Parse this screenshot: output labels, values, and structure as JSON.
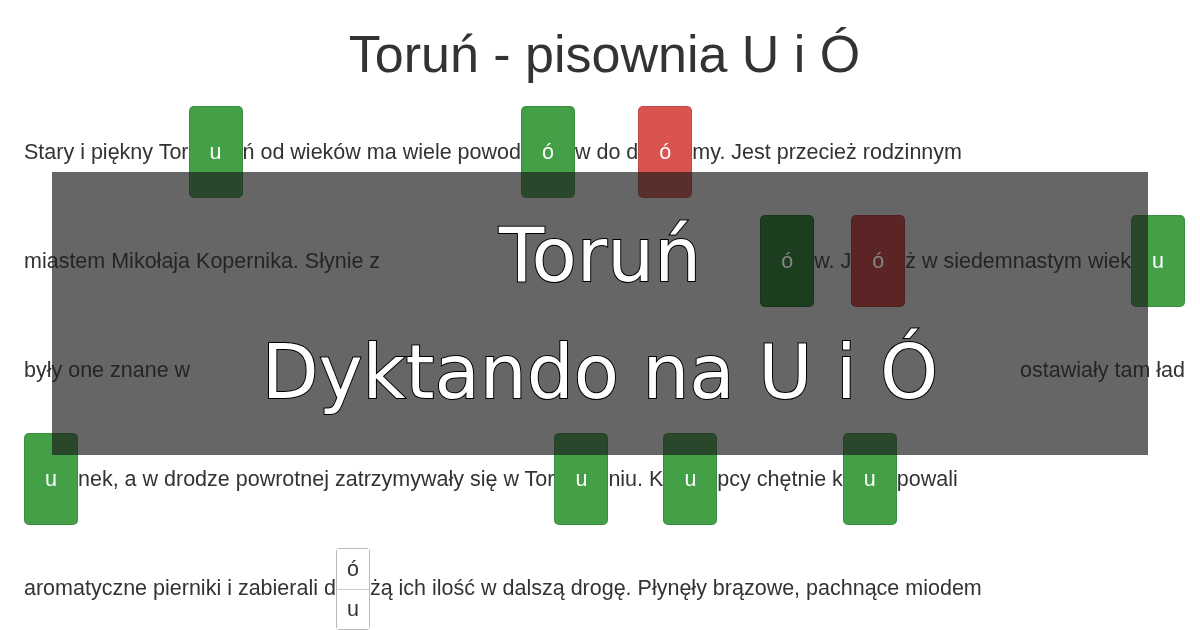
{
  "title": "Toruń - pisownia U i Ó",
  "lines": [
    {
      "segments": [
        {
          "kind": "text",
          "text": "Stary i piękny Tor"
        },
        {
          "kind": "answer",
          "letter": "u",
          "color": "#43a047"
        },
        {
          "kind": "text",
          "text": "ń od wieków ma wiele powod"
        },
        {
          "kind": "answer",
          "letter": "ó",
          "color": "#43a047"
        },
        {
          "kind": "text",
          "text": "w do d"
        },
        {
          "kind": "answer",
          "letter": "ó",
          "color": "#d9534f"
        },
        {
          "kind": "text",
          "text": "my. Jest przecież rodzinnym"
        }
      ]
    },
    {
      "segments": [
        {
          "kind": "text",
          "text": "miastem Mikołaja Kopernika. Słynie z"
        }
      ],
      "right": [
        {
          "kind": "answer",
          "letter": "ó",
          "color": "#1c3d1e"
        },
        {
          "kind": "text",
          "text": "w. J"
        },
        {
          "kind": "answer",
          "letter": "ó",
          "color": "#5a2524"
        },
        {
          "kind": "text",
          "text": "ż w siedemnastym wiek"
        },
        {
          "kind": "answer",
          "letter": "u",
          "color": "#43a047"
        }
      ]
    },
    {
      "segments": [
        {
          "kind": "text",
          "text": "były one znane w"
        }
      ],
      "right": [
        {
          "kind": "text",
          "text": "ostawiały tam ład"
        }
      ]
    },
    {
      "segments": [
        {
          "kind": "answer",
          "letter": "u",
          "color": "#43a047"
        },
        {
          "kind": "text",
          "text": "nek, a w drodze powrotnej zatrzymywały się w Tor"
        },
        {
          "kind": "answer",
          "letter": "u",
          "color": "#43a047"
        },
        {
          "kind": "text",
          "text": "niu. K"
        },
        {
          "kind": "answer",
          "letter": "u",
          "color": "#43a047"
        },
        {
          "kind": "text",
          "text": "pcy chętnie k"
        },
        {
          "kind": "answer",
          "letter": "u",
          "color": "#43a047"
        },
        {
          "kind": "text",
          "text": "powali"
        }
      ]
    },
    {
      "segments": [
        {
          "kind": "text",
          "text": "aromatyczne pierniki i zabierali d"
        },
        {
          "kind": "choice",
          "options": [
            "ó",
            "u"
          ]
        },
        {
          "kind": "text",
          "text": "żą ich ilość w dalszą drogę. Płynęły brązowe, pachnące miodem"
        }
      ]
    }
  ],
  "banner": {
    "lines": [
      "Toruń",
      "Dyktando na U i Ó"
    ]
  }
}
